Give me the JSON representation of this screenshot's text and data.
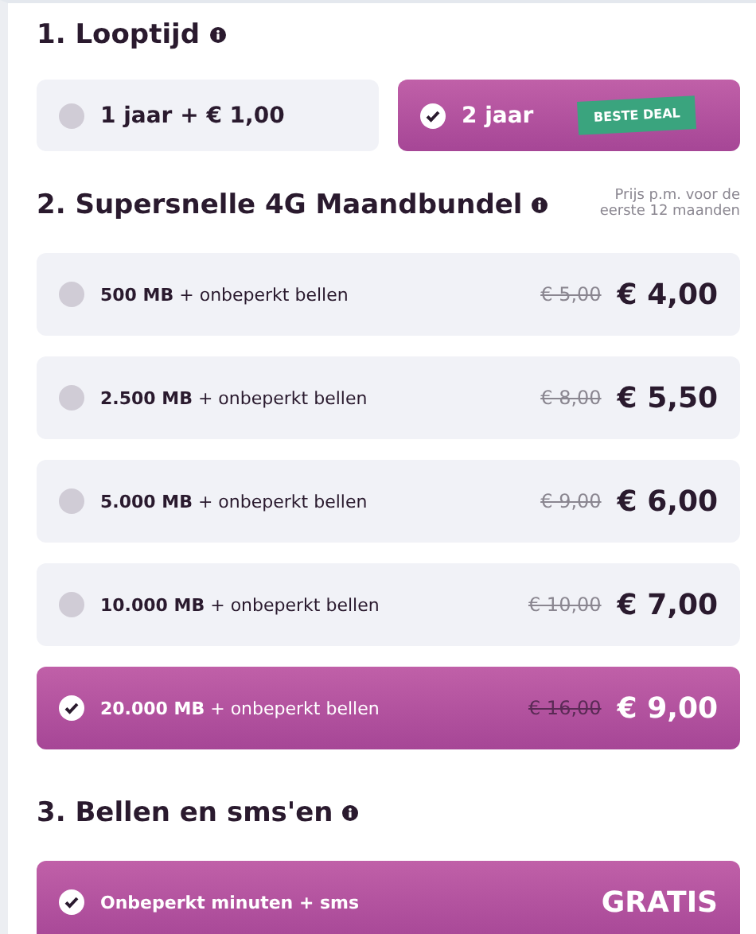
{
  "sections": [
    {
      "title": "1. Looptijd",
      "kind": "duration",
      "options": [
        {
          "label": "1 jaar + € 1,00",
          "selected": false
        },
        {
          "label": "2 jaar",
          "selected": true,
          "badge": "BESTE DEAL"
        }
      ]
    },
    {
      "title": "2. Supersnelle 4G Maandbundel",
      "kind": "bundle",
      "note": "Prijs p.m. voor de eerste 12 maanden",
      "options": [
        {
          "label": "**500 MB** + onbeperkt bellen",
          "old_price": "€ 5,00",
          "price": "€ 4,00",
          "selected": false
        },
        {
          "label": "**2.500 MB** + onbeperkt bellen",
          "old_price": "€ 8,00",
          "price": "€ 5,50",
          "selected": false
        },
        {
          "label": "**5.000 MB** + onbeperkt bellen",
          "old_price": "€ 9,00",
          "price": "€ 6,00",
          "selected": false
        },
        {
          "label": "**10.000 MB** + onbeperkt bellen",
          "old_price": "€ 10,00",
          "price": "€ 7,00",
          "selected": false
        },
        {
          "label": "**20.000 MB** + onbeperkt bellen",
          "old_price": "€ 16,00",
          "price": "€ 9,00",
          "selected": true
        }
      ]
    },
    {
      "title": "3. Bellen en sms'en",
      "kind": "bundle",
      "options": [
        {
          "label": "**Onbeperkt minuten + sms**",
          "price": "GRATIS",
          "selected": true
        }
      ]
    }
  ]
}
